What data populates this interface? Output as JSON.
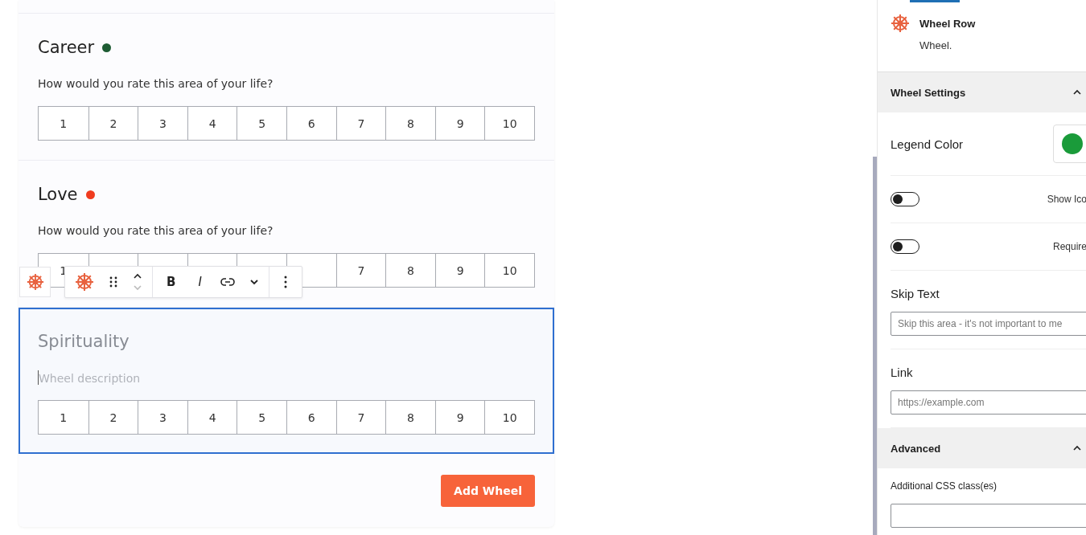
{
  "wheels": [
    {
      "title": "Career",
      "color": "#1e5c33",
      "description": "How would you rate this area of your life?",
      "selected": false,
      "scale": [
        {
          "label": "1"
        },
        {
          "label": "2"
        },
        {
          "label": "3"
        },
        {
          "label": "4"
        },
        {
          "label": "5"
        },
        {
          "label": "6"
        },
        {
          "label": "7"
        },
        {
          "label": "8"
        },
        {
          "label": "9"
        },
        {
          "label": "10"
        }
      ]
    },
    {
      "title": "Love",
      "color": "#f03c1f",
      "description": "How would you rate this area of your life?",
      "selected": false,
      "scale": [
        {
          "label": "1"
        }
      ],
      "scale_end": [
        {
          "label": "7"
        },
        {
          "label": "8"
        },
        {
          "label": "9"
        },
        {
          "label": "10"
        }
      ]
    },
    {
      "title_placeholder": "Spirituality",
      "description_placeholder": "Wheel description",
      "selected": true,
      "scale": [
        {
          "label": "1"
        },
        {
          "label": "2"
        },
        {
          "label": "3"
        },
        {
          "label": "4"
        },
        {
          "label": "5"
        },
        {
          "label": "6"
        },
        {
          "label": "7"
        },
        {
          "label": "8"
        },
        {
          "label": "9"
        },
        {
          "label": "10"
        }
      ]
    }
  ],
  "toolbar": {
    "format_buttons": [
      {
        "kind": "bold",
        "label": "B"
      },
      {
        "kind": "italic",
        "label": "I"
      }
    ]
  },
  "add_button": "Add Wheel",
  "sidebar": {
    "block": {
      "name": "Wheel Row",
      "description": "Wheel."
    },
    "panels": [
      {
        "title": "Wheel Settings",
        "expanded": true,
        "fields": [
          {
            "kind": "color",
            "label": "Legend Color",
            "color": "#1a9b3a"
          },
          {
            "kind": "toggle",
            "label": "Show Ico",
            "on": false
          },
          {
            "kind": "toggle",
            "label": "Require",
            "on": false
          },
          {
            "kind": "text",
            "label": "Skip Text",
            "placeholder": "Skip this area - it's not important to me"
          },
          {
            "kind": "text",
            "label": "Link",
            "placeholder": "https://example.com"
          }
        ]
      },
      {
        "title": "Advanced",
        "expanded": true,
        "fields": [
          {
            "kind": "compact",
            "label": "Additional CSS class(es)"
          }
        ]
      }
    ]
  }
}
